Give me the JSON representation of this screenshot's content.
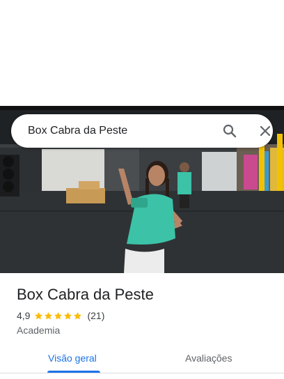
{
  "search": {
    "query": "Box Cabra da Peste",
    "search_icon": "search-icon",
    "close_icon": "close-icon"
  },
  "place": {
    "name": "Box Cabra da Peste",
    "rating": "4,9",
    "stars": 5,
    "review_count": "(21)",
    "category": "Academia"
  },
  "tabs": [
    {
      "label": "Visão geral",
      "active": true
    },
    {
      "label": "Avaliações",
      "active": false
    }
  ],
  "colors": {
    "accent": "#1a73e8",
    "star": "#fbbc04",
    "shirt": "#3cc2a6"
  }
}
